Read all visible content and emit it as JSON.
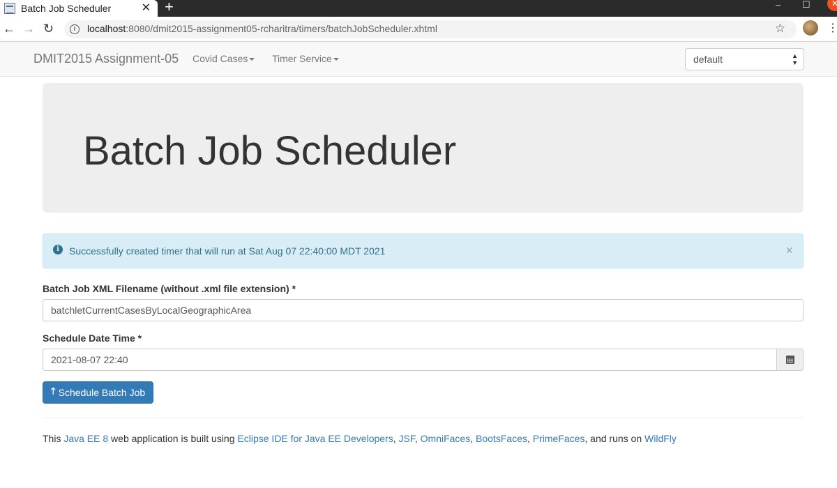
{
  "browser": {
    "tab_title": "Batch Job Scheduler",
    "new_tab_symbol": "+",
    "url_host": "localhost",
    "url_rest": ":8080/dmit2015-assignment05-rcharitra/timers/batchJobScheduler.xhtml"
  },
  "navbar": {
    "brand": "DMIT2015 Assignment-05",
    "menu1": "Covid Cases",
    "menu2": "Timer Service",
    "theme_value": "default"
  },
  "jumbotron": {
    "title": "Batch Job Scheduler"
  },
  "alert": {
    "message": "Successfully created timer that will run at Sat Aug 07 22:40:00 MDT 2021",
    "close_symbol": "×"
  },
  "form": {
    "filename_label": "Batch Job XML Filename (without .xml file extension) *",
    "filename_value": "batchletCurrentCasesByLocalGeographicArea",
    "datetime_label": "Schedule Date Time *",
    "datetime_value": "2021-08-07 22:40",
    "submit_label": "Schedule Batch Job"
  },
  "footer": {
    "p1": "This ",
    "java_ee": "Java EE 8",
    "p2": " web application is built using ",
    "eclipse": "Eclipse IDE for Java EE Developers",
    "sep1": ", ",
    "jsf": "JSF",
    "sep2": ", ",
    "omnifaces": "OmniFaces",
    "sep3": ", ",
    "bootsfaces": "BootsFaces",
    "sep4": ", ",
    "primefaces": "PrimeFaces",
    "p3": ", and runs on ",
    "wildfly": "WildFly"
  }
}
